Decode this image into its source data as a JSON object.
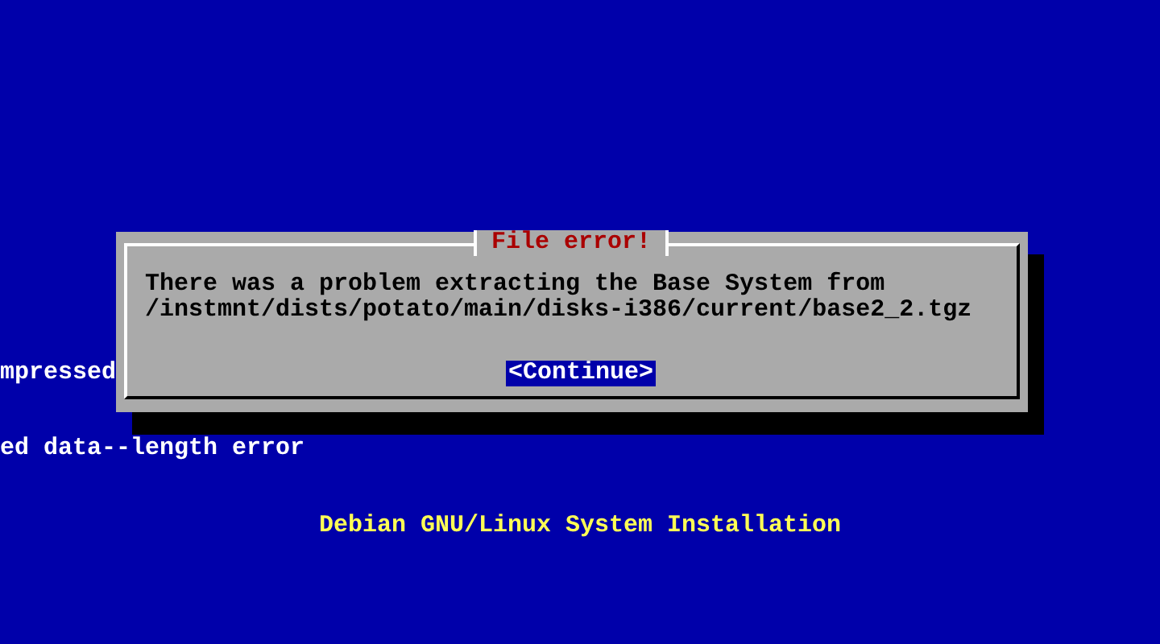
{
  "background_lines": [
    "mpressed",
    "ed data--length error"
  ],
  "footer": "Debian GNU/Linux System Installation",
  "dialog": {
    "title": "File error!",
    "message": [
      "There was a problem extracting the Base System from",
      "/instmnt/dists/potato/main/disks-i386/current/base2_2.tgz"
    ],
    "buttons": [
      {
        "label": "<Continue>",
        "selected": true
      }
    ]
  }
}
